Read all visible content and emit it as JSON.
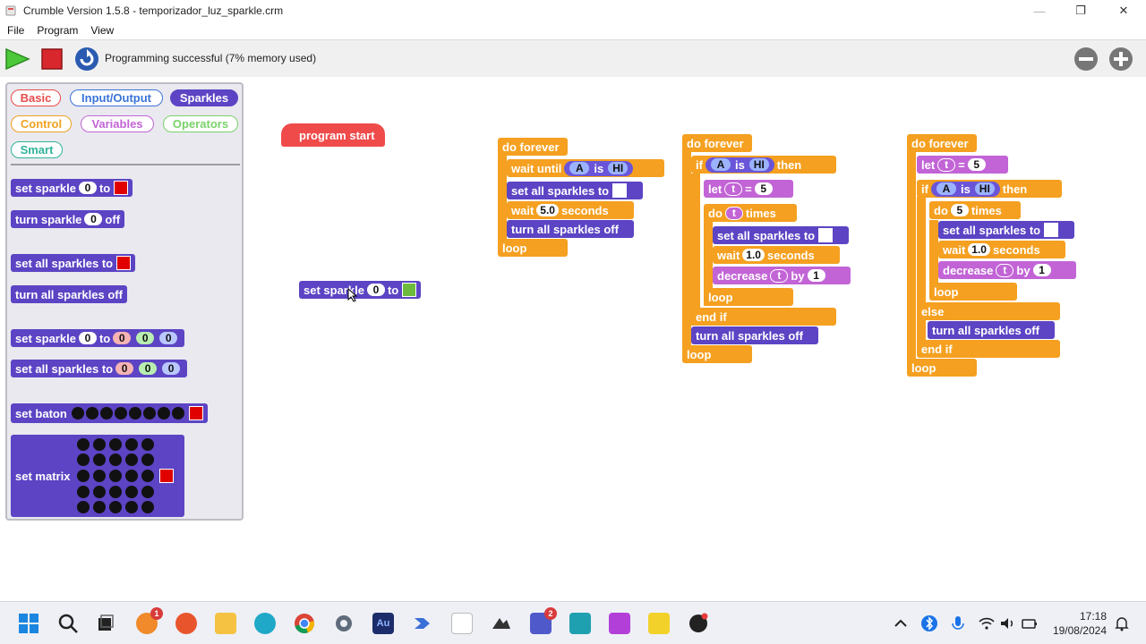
{
  "window": {
    "title": "Crumble Version 1.5.8 - temporizador_luz_sparkle.crm",
    "minimize": "—",
    "maximize": "❐",
    "close": "✕"
  },
  "menu": {
    "file": "File",
    "program": "Program",
    "view": "View"
  },
  "toolbar": {
    "status": "Programming successful (7% memory used)"
  },
  "palette": {
    "categories": {
      "basic": "Basic",
      "io": "Input/Output",
      "sparkles": "Sparkles",
      "control": "Control",
      "variables": "Variables",
      "operators": "Operators",
      "smart": "Smart"
    },
    "set_sparkle": "set sparkle",
    "to": "to",
    "zero": "0",
    "turn_sparkle": "turn sparkle",
    "off": "off",
    "set_all_sparkles": "set all sparkles to",
    "turn_all_off": "turn all sparkles off",
    "set_baton": "set baton",
    "set_matrix": "set matrix"
  },
  "canvas": {
    "program_start": "program start",
    "do_forever": "do forever",
    "wait_until": "wait until",
    "A": "A",
    "is": "is",
    "HI": "HI",
    "set_all_sparkles": "set all sparkles to",
    "wait": "wait",
    "seconds": "seconds",
    "five_point_zero": "5.0",
    "one_point_zero": "1.0",
    "turn_all_off": "turn all sparkles off",
    "loop": "loop",
    "if": "if",
    "then": "then",
    "else": "else",
    "end_if": "end if",
    "let": "let",
    "t": "t",
    "eq": "=",
    "five": "5",
    "one": "1",
    "zero": "0",
    "do": "do",
    "times": "times",
    "decrease": "decrease",
    "by": "by",
    "set_sparkle": "set sparkle",
    "to": "to"
  },
  "taskbar": {
    "time": "17:18",
    "date": "19/08/2024",
    "badge_one": "1",
    "badge_two": "2",
    "au": "Au"
  },
  "colors": {
    "purple": "#5c44c4",
    "orange": "#f5a020",
    "violet": "#c264d6",
    "red_block": "#ef4b4b",
    "swatch_red": "#e00000",
    "swatch_green": "#6dbb3c"
  }
}
